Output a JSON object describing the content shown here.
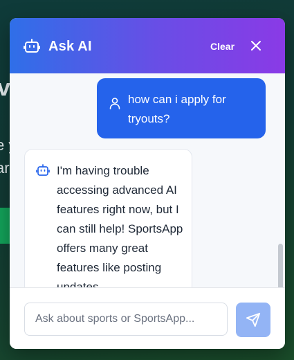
{
  "background": {
    "fragments": [
      "vo",
      "e y",
      "ar"
    ]
  },
  "chat": {
    "title": "Ask AI",
    "clear_label": "Clear",
    "messages": [
      {
        "role": "user",
        "text": "how can i apply for tryouts?"
      },
      {
        "role": "assistant",
        "text": "I'm having trouble accessing advanced AI features right now, but I can still help! SportsApp offers many great features like posting updates"
      }
    ],
    "input": {
      "placeholder": "Ask about sports or SportsApp...",
      "value": ""
    }
  },
  "colors": {
    "header_start": "#2f6fe8",
    "header_end": "#8a3ae6",
    "user_bubble": "#2563eb",
    "send_button": "#93b4f5"
  },
  "icons": [
    "bot-icon",
    "close-icon",
    "user-icon",
    "send-icon"
  ]
}
